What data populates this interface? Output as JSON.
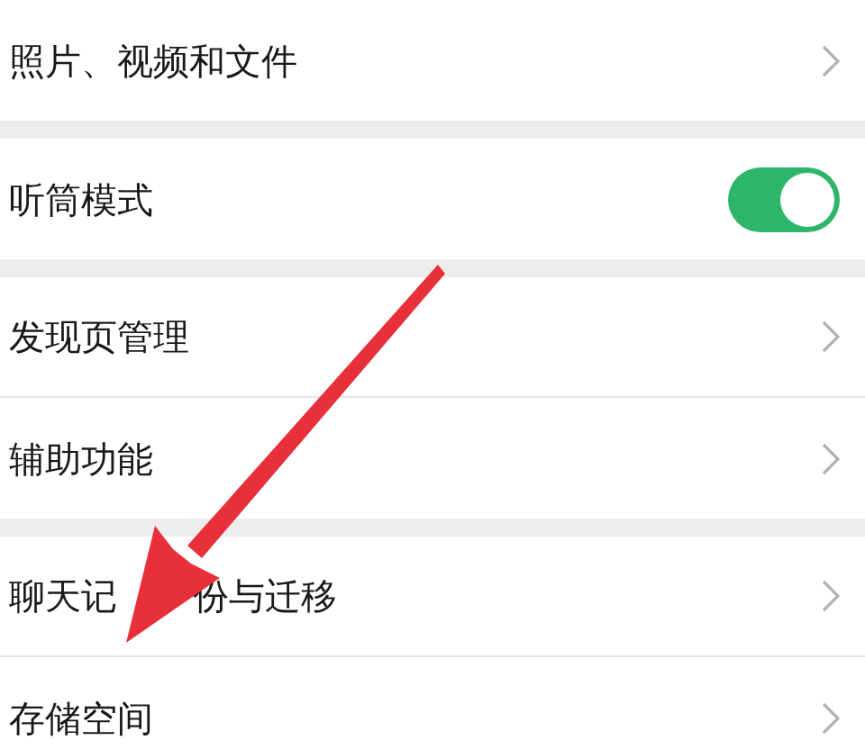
{
  "groups": [
    {
      "items": [
        {
          "kind": "link",
          "label": "照片、视频和文件"
        }
      ]
    },
    {
      "items": [
        {
          "kind": "toggle",
          "label": "听筒模式",
          "on": true
        }
      ]
    },
    {
      "items": [
        {
          "kind": "link",
          "label": "发现页管理"
        },
        {
          "kind": "link",
          "label": "辅助功能"
        }
      ]
    },
    {
      "items": [
        {
          "kind": "link",
          "label_parts": [
            "聊天记",
            "份与迁移"
          ]
        },
        {
          "kind": "link",
          "label": "存储空间"
        }
      ]
    }
  ],
  "annotation": {
    "kind": "arrow"
  }
}
